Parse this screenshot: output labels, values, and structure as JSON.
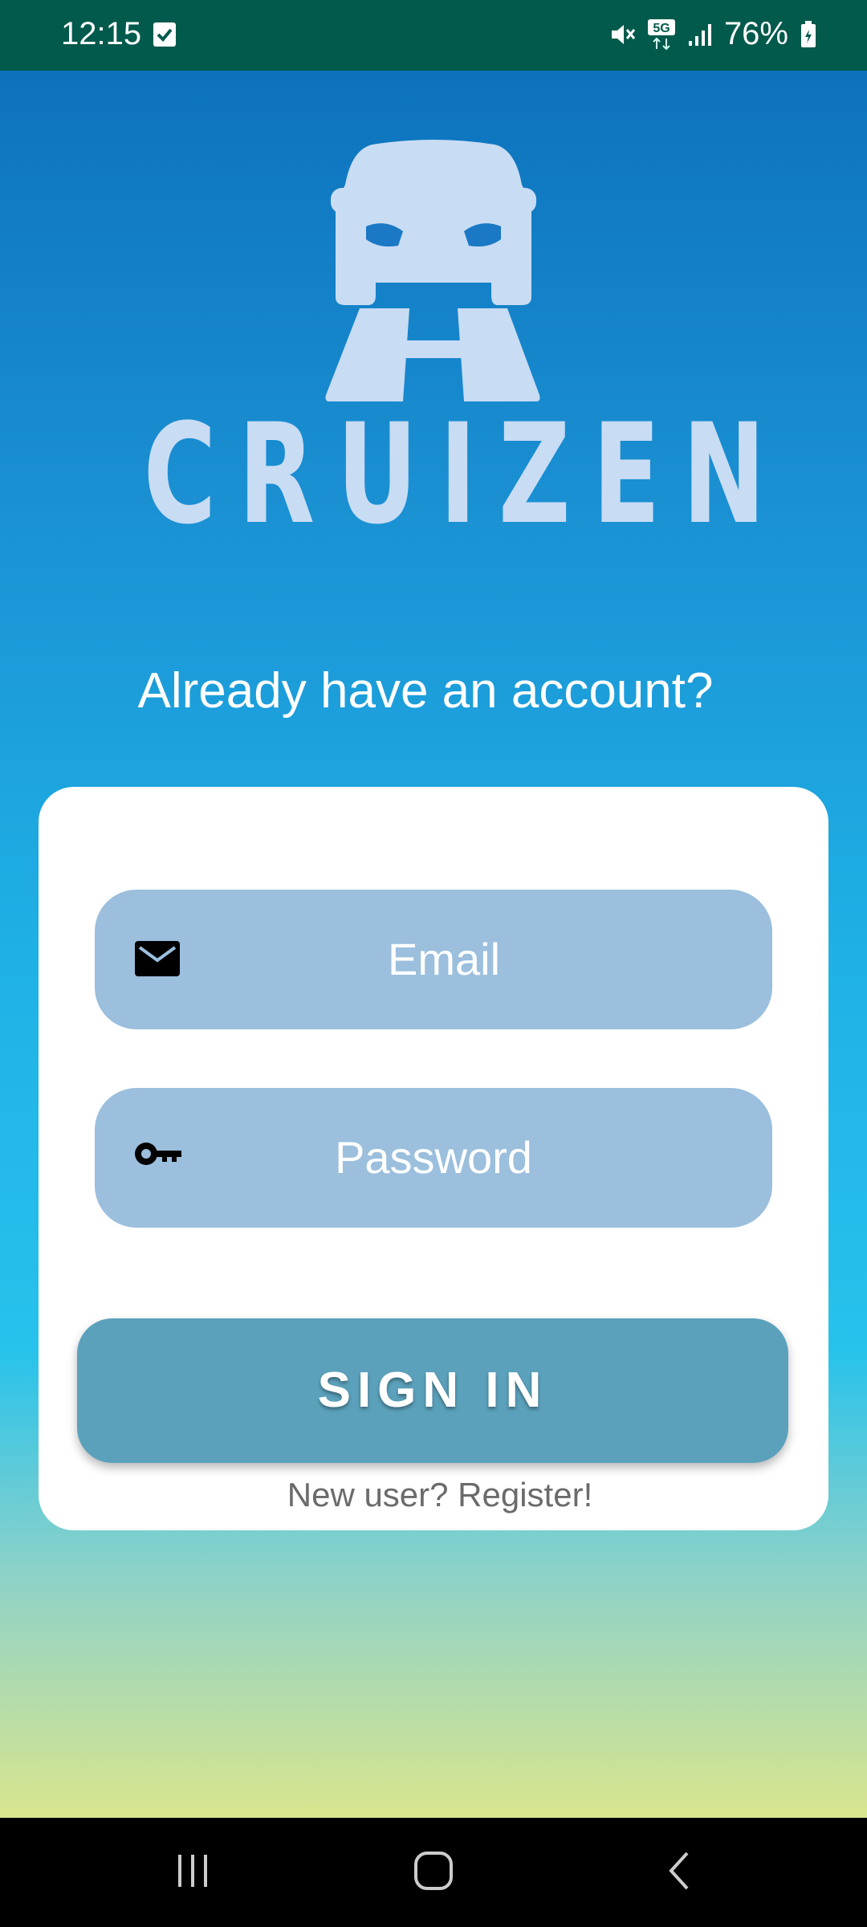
{
  "status_bar": {
    "time": "12:15",
    "battery": "76%",
    "network": "5G",
    "icons": [
      "check-box-icon",
      "mute-icon",
      "5g-icon",
      "signal-icon",
      "battery-icon"
    ]
  },
  "brand": {
    "name": "CRUIZEN",
    "logo": "car-on-road-icon"
  },
  "headline": "Already have an account?",
  "form": {
    "email_placeholder": "Email",
    "password_placeholder": "Password",
    "signin_label": "SIGN IN",
    "register_link": "New user? Register!"
  },
  "colors": {
    "status_bar": "#025a4c",
    "logo": "#c8dcf4",
    "field_bg": "#9bbfdd",
    "button_bg": "#5ba1bb",
    "link_text": "#6b6b6b"
  },
  "nav_bar": {
    "icons": [
      "recents-icon",
      "home-icon",
      "back-icon"
    ]
  }
}
